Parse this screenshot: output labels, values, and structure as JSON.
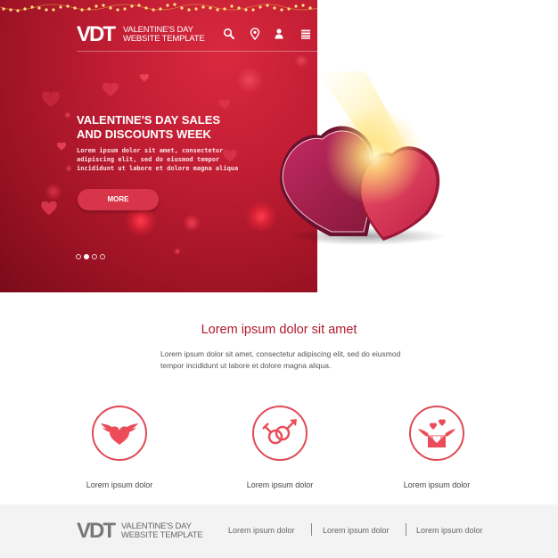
{
  "hero": {
    "logo": "VDT",
    "logo_line1": "VALENTINE'S DAY",
    "logo_line2": "WEBSITE TEMPLATE",
    "nav_icons": [
      "search-icon",
      "location-pin-icon",
      "user-icon",
      "menu-list-icon"
    ],
    "title_line1": "VALENTINE'S DAY SALES",
    "title_line2": "AND DISCOUNTS WEEK",
    "text_line1": "Lorem ipsum dolor sit amet, consectetur",
    "text_line2": "adipiscing elit, sed do eiusmod tempor",
    "text_line3": "incididunt ut labore et dolore magna aliqua",
    "button_label": "MORE",
    "slides_total": 4,
    "slide_active": 2
  },
  "intro": {
    "title": "Lorem ipsum dolor sit amet",
    "text": "Lorem ipsum dolor sit amet, consectetur adipiscing elit, sed do eiusmod tempor incididunt ut labore et dolore magna aliqua."
  },
  "features": [
    {
      "icon": "winged-heart-icon",
      "label": "Lorem ipsum dolor"
    },
    {
      "icon": "gender-symbols-icon",
      "label": "Lorem ipsum dolor"
    },
    {
      "icon": "love-letter-icon",
      "label": "Lorem ipsum dolor"
    }
  ],
  "footer": {
    "logo": "VDT",
    "logo_line1": "VALENTINE'S DAY",
    "logo_line2": "WEBSITE TEMPLATE",
    "links": [
      "Lorem ipsum dolor",
      "Lorem ipsum dolor",
      "Lorem ipsum dolor"
    ]
  },
  "colors": {
    "brand_red": "#c11d33",
    "accent_red": "#b0192c",
    "icon_red": "#e04a55",
    "footer_bg": "#f3f3f3"
  }
}
